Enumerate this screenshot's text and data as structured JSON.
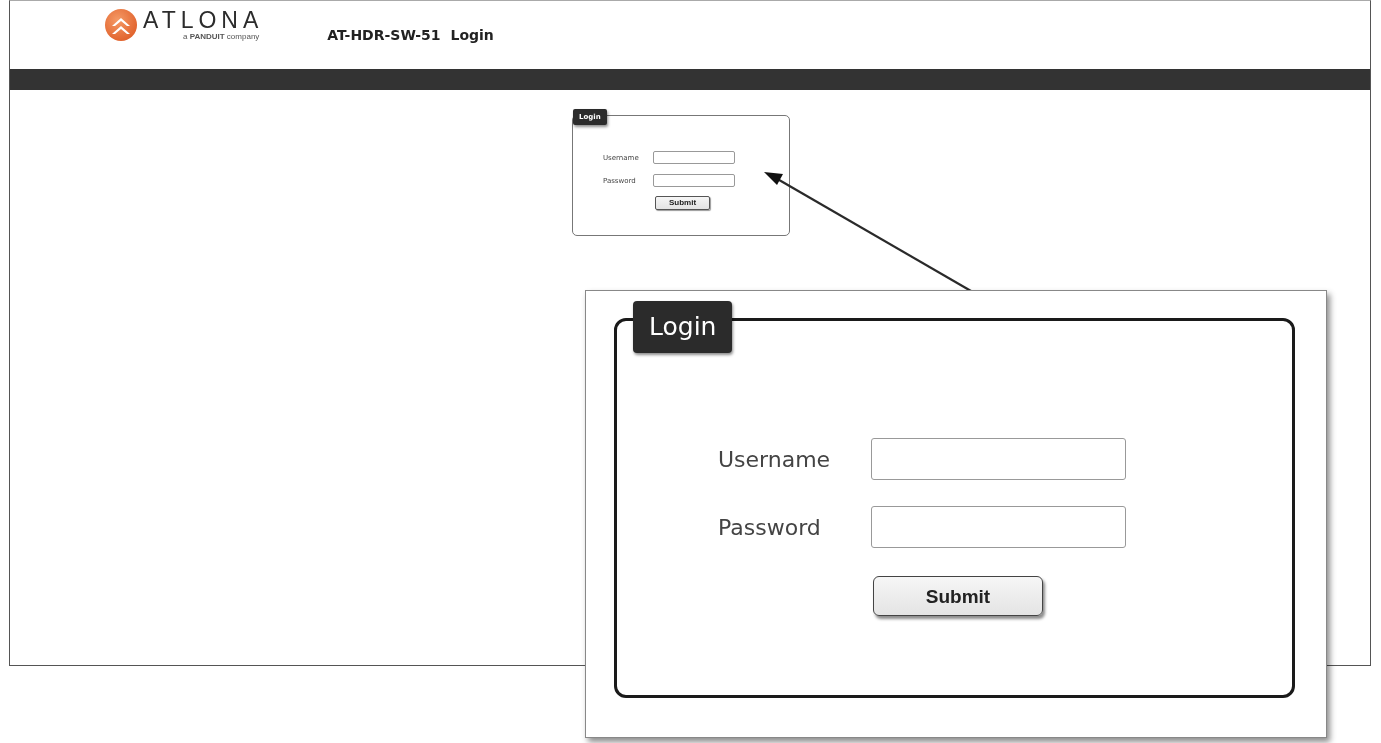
{
  "header": {
    "logo": {
      "wordmark": "ATLONA",
      "tagline": "a **PANDUIT** company"
    },
    "device_name": "AT-HDR-SW-51",
    "page_title": "Login"
  },
  "login_panel": {
    "legend": "Login",
    "fields": [
      {
        "label": "Username"
      },
      {
        "label": "Password"
      }
    ],
    "submit": "Submit"
  },
  "callout": {
    "legend": "Login",
    "fields": [
      {
        "label": "Username"
      },
      {
        "label": "Password"
      }
    ],
    "submit": "Submit"
  }
}
